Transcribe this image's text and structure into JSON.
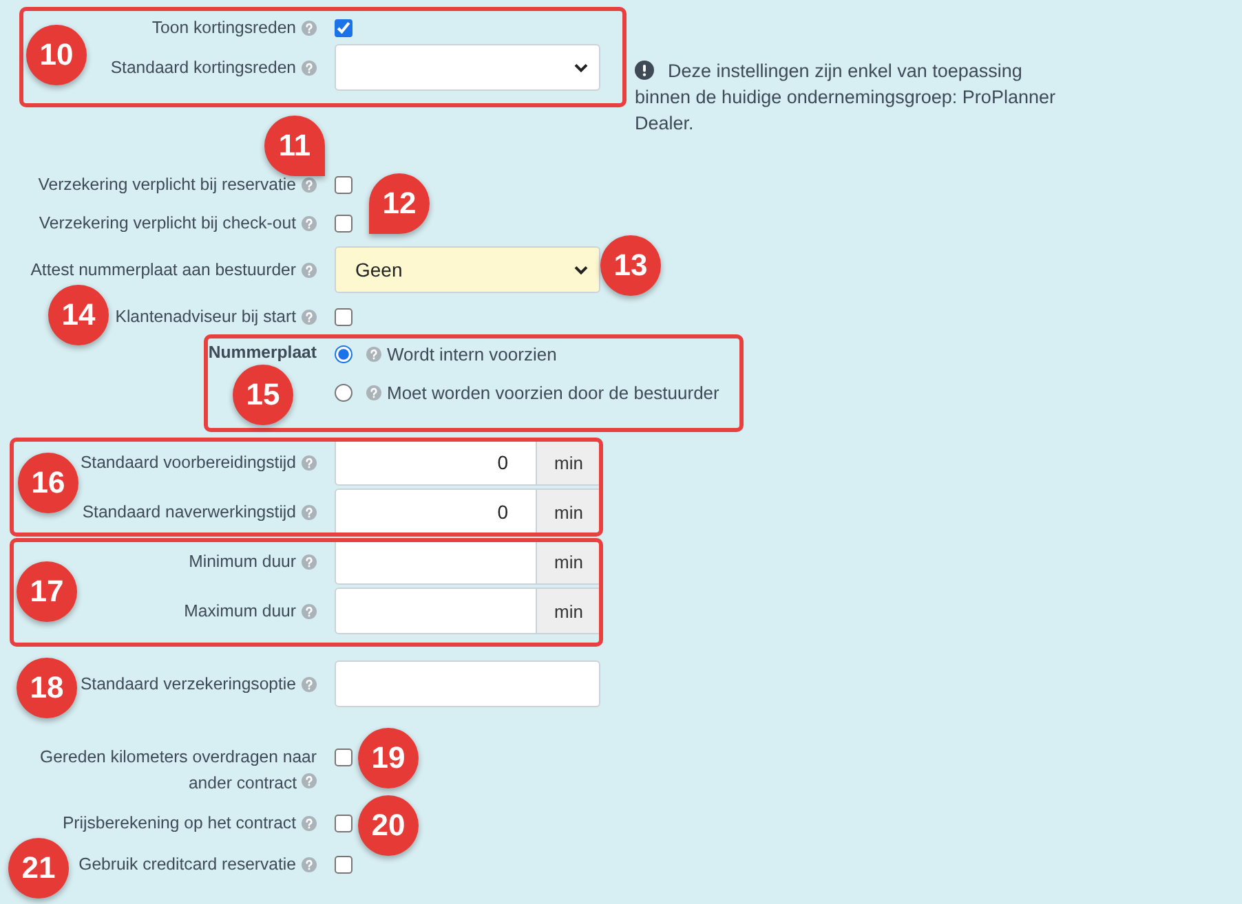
{
  "note": "Deze instellingen zijn enkel van toepassing binnen de huidige ondernemingsgroep: ProPlanner Dealer.",
  "sections": [
    {
      "rows": [
        {
          "kind": "checkbox",
          "label": "Toon kortingsreden",
          "help": true,
          "checked": true
        },
        {
          "kind": "select",
          "label": "Standaard kortingsreden",
          "help": true,
          "highlighted": false
        }
      ]
    },
    {
      "rows": [
        {
          "kind": "checkbox",
          "label": "Verzekering verplicht bij reservatie",
          "help": true,
          "checked": false
        },
        {
          "kind": "checkbox",
          "label": "Verzekering verplicht bij check-out",
          "help": true,
          "checked": false
        },
        {
          "kind": "select",
          "label": "Attest nummerplaat aan bestuurder",
          "help": true,
          "value": "Geen",
          "highlighted": true
        },
        {
          "kind": "checkbox",
          "label": "Klantenadviseur bij start",
          "help": true,
          "checked": false
        },
        {
          "kind": "radio",
          "label": "Nummerplaat",
          "help": false,
          "options": [
            {
              "label": "Wordt intern voorzien",
              "selected": true
            },
            {
              "label": "Moet worden voorzien door de bestuurder",
              "selected": false
            }
          ]
        }
      ]
    },
    {
      "rows": [
        {
          "kind": "number",
          "label": "Standaard voorbereidingstijd",
          "help": true,
          "value": "0",
          "unit": "min"
        },
        {
          "kind": "number",
          "label": "Standaard naverwerkingstijd",
          "help": true,
          "value": "0",
          "unit": "min"
        },
        {
          "kind": "number",
          "label": "Minimum duur",
          "help": true,
          "unit": "min"
        },
        {
          "kind": "number",
          "label": "Maximum duur",
          "help": true,
          "unit": "min"
        }
      ]
    },
    {
      "rows": [
        {
          "kind": "text",
          "label": "Standaard verzekeringsoptie",
          "help": true
        }
      ]
    },
    {
      "rows": [
        {
          "kind": "checkbox",
          "label": "Gereden kilometers overdragen naar ander contract",
          "help": true,
          "checked": false
        },
        {
          "kind": "checkbox",
          "label": "Prijsberekening op het contract",
          "help": true,
          "checked": false
        },
        {
          "kind": "checkbox",
          "label": "Gebruik creditcard reservatie",
          "help": true,
          "checked": false
        }
      ]
    }
  ],
  "callouts": [
    "10",
    "11",
    "12",
    "13",
    "14",
    "15",
    "16",
    "17",
    "18",
    "19",
    "20",
    "21"
  ]
}
